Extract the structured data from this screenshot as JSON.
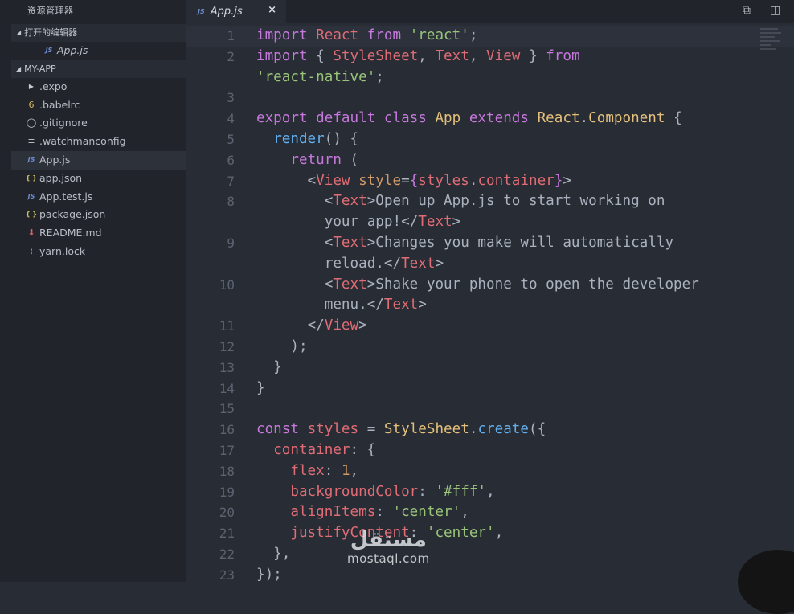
{
  "sidebar": {
    "title": "资源管理器",
    "open_editors": {
      "label": "打开的编辑器",
      "items": [
        {
          "icon": "JS",
          "name": "App.js"
        }
      ]
    },
    "project": {
      "label": "MY-APP"
    },
    "files": [
      {
        "icon": "arrow",
        "name": ".expo"
      },
      {
        "icon": "babel",
        "name": ".babelrc"
      },
      {
        "icon": "git",
        "name": ".gitignore"
      },
      {
        "icon": "cfg",
        "name": ".watchmanconfig"
      },
      {
        "icon": "JS",
        "name": "App.js"
      },
      {
        "icon": "json",
        "name": "app.json"
      },
      {
        "icon": "JS",
        "name": "App.test.js"
      },
      {
        "icon": "json",
        "name": "package.json"
      },
      {
        "icon": "md",
        "name": "README.md"
      },
      {
        "icon": "yarn",
        "name": "yarn.lock"
      }
    ]
  },
  "tab": {
    "icon": "JS",
    "name": "App.js",
    "close": "×"
  },
  "code_lines": [
    {
      "n": "1",
      "tokens": [
        [
          "kw",
          "import "
        ],
        [
          "id",
          "React "
        ],
        [
          "kw",
          "from "
        ],
        [
          "str",
          "'react'"
        ],
        [
          "pl",
          ";"
        ]
      ]
    },
    {
      "n": "2",
      "tokens": [
        [
          "kw",
          "import "
        ],
        [
          "pl",
          "{ "
        ],
        [
          "id",
          "StyleSheet"
        ],
        [
          "pl",
          ", "
        ],
        [
          "id",
          "Text"
        ],
        [
          "pl",
          ", "
        ],
        [
          "id",
          "View"
        ],
        [
          "pl",
          " } "
        ],
        [
          "kw",
          "from"
        ]
      ]
    },
    {
      "n": "",
      "tokens": [
        [
          "str",
          "'react-native'"
        ],
        [
          "pl",
          ";"
        ]
      ]
    },
    {
      "n": "3",
      "tokens": []
    },
    {
      "n": "4",
      "tokens": [
        [
          "kw",
          "export default class "
        ],
        [
          "cls",
          "App "
        ],
        [
          "kw",
          "extends "
        ],
        [
          "cls",
          "React"
        ],
        [
          "pl",
          "."
        ],
        [
          "cls",
          "Component "
        ],
        [
          "pl",
          "{"
        ]
      ]
    },
    {
      "n": "5",
      "tokens": [
        [
          "pl",
          "  "
        ],
        [
          "fn",
          "render"
        ],
        [
          "pl",
          "() {"
        ]
      ]
    },
    {
      "n": "6",
      "tokens": [
        [
          "pl",
          "    "
        ],
        [
          "kw",
          "return "
        ],
        [
          "pl",
          "("
        ]
      ]
    },
    {
      "n": "7",
      "tokens": [
        [
          "pl",
          "      <"
        ],
        [
          "id",
          "View "
        ],
        [
          "num",
          "style"
        ],
        [
          "pl",
          "="
        ],
        [
          "kw",
          "{"
        ],
        [
          "id",
          "styles"
        ],
        [
          "pl",
          "."
        ],
        [
          "id",
          "container"
        ],
        [
          "kw",
          "}"
        ],
        [
          "pl",
          ">"
        ]
      ]
    },
    {
      "n": "8",
      "tokens": [
        [
          "pl",
          "        <"
        ],
        [
          "id",
          "Text"
        ],
        [
          "pl",
          ">Open up App.js to start working on"
        ]
      ]
    },
    {
      "n": "",
      "tokens": [
        [
          "pl",
          "        your app!</"
        ],
        [
          "id",
          "Text"
        ],
        [
          "pl",
          ">"
        ]
      ]
    },
    {
      "n": "9",
      "tokens": [
        [
          "pl",
          "        <"
        ],
        [
          "id",
          "Text"
        ],
        [
          "pl",
          ">Changes you make will automatically"
        ]
      ]
    },
    {
      "n": "",
      "tokens": [
        [
          "pl",
          "        reload.</"
        ],
        [
          "id",
          "Text"
        ],
        [
          "pl",
          ">"
        ]
      ]
    },
    {
      "n": "10",
      "tokens": [
        [
          "pl",
          "        <"
        ],
        [
          "id",
          "Text"
        ],
        [
          "pl",
          ">Shake your phone to open the developer"
        ]
      ]
    },
    {
      "n": "",
      "tokens": [
        [
          "pl",
          "        menu.</"
        ],
        [
          "id",
          "Text"
        ],
        [
          "pl",
          ">"
        ]
      ]
    },
    {
      "n": "11",
      "tokens": [
        [
          "pl",
          "      </"
        ],
        [
          "id",
          "View"
        ],
        [
          "pl",
          ">"
        ]
      ]
    },
    {
      "n": "12",
      "tokens": [
        [
          "pl",
          "    );"
        ]
      ]
    },
    {
      "n": "13",
      "tokens": [
        [
          "pl",
          "  }"
        ]
      ]
    },
    {
      "n": "14",
      "tokens": [
        [
          "pl",
          "}"
        ]
      ]
    },
    {
      "n": "15",
      "tokens": []
    },
    {
      "n": "16",
      "tokens": [
        [
          "kw",
          "const "
        ],
        [
          "id",
          "styles "
        ],
        [
          "pl",
          "= "
        ],
        [
          "cls",
          "StyleSheet"
        ],
        [
          "pl",
          "."
        ],
        [
          "fn",
          "create"
        ],
        [
          "pl",
          "({"
        ]
      ]
    },
    {
      "n": "17",
      "tokens": [
        [
          "pl",
          "  "
        ],
        [
          "id",
          "container"
        ],
        [
          "pl",
          ": {"
        ]
      ]
    },
    {
      "n": "18",
      "tokens": [
        [
          "pl",
          "    "
        ],
        [
          "id",
          "flex"
        ],
        [
          "pl",
          ": "
        ],
        [
          "num",
          "1"
        ],
        [
          "pl",
          ","
        ]
      ]
    },
    {
      "n": "19",
      "tokens": [
        [
          "pl",
          "    "
        ],
        [
          "id",
          "backgroundColor"
        ],
        [
          "pl",
          ": "
        ],
        [
          "str",
          "'#fff'"
        ],
        [
          "pl",
          ","
        ]
      ]
    },
    {
      "n": "20",
      "tokens": [
        [
          "pl",
          "    "
        ],
        [
          "id",
          "alignItems"
        ],
        [
          "pl",
          ": "
        ],
        [
          "str",
          "'center'"
        ],
        [
          "pl",
          ","
        ]
      ]
    },
    {
      "n": "21",
      "tokens": [
        [
          "pl",
          "    "
        ],
        [
          "id",
          "justifyContent"
        ],
        [
          "pl",
          ": "
        ],
        [
          "str",
          "'center'"
        ],
        [
          "pl",
          ","
        ]
      ]
    },
    {
      "n": "22",
      "tokens": [
        [
          "pl",
          "  },"
        ]
      ]
    },
    {
      "n": "23",
      "tokens": [
        [
          "pl",
          "});"
        ]
      ]
    }
  ],
  "watermark": {
    "arabic": "مستقل",
    "latin": "mostaql.com"
  },
  "toolbar_icons": [
    "search-diff-icon",
    "split-editor-icon"
  ]
}
